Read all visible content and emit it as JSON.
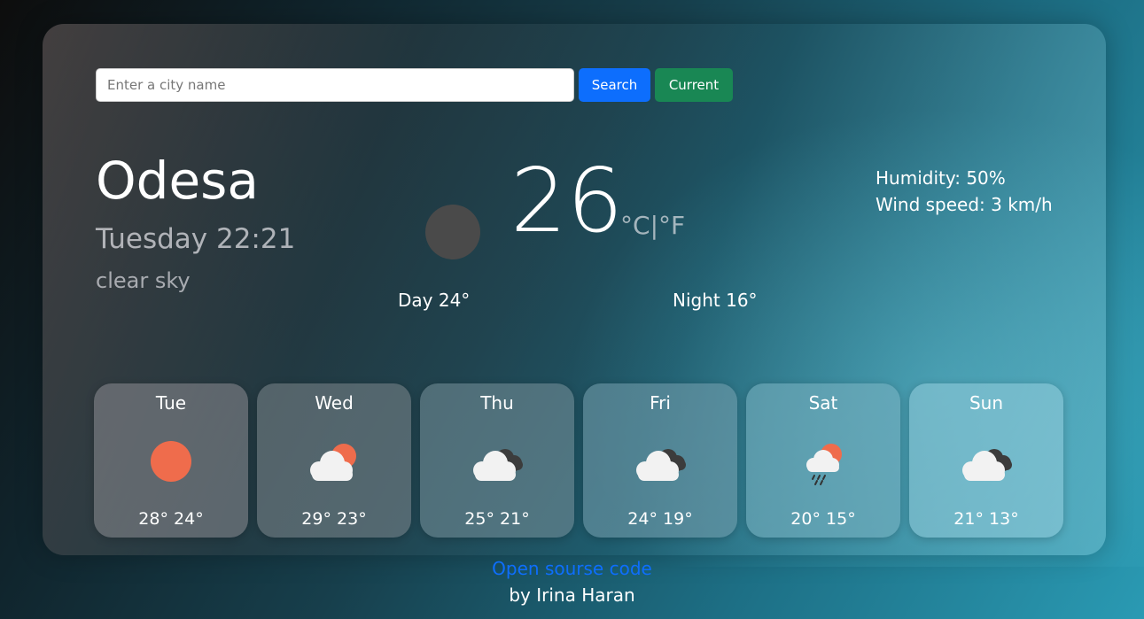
{
  "search": {
    "placeholder": "Enter a city name",
    "search_label": "Search",
    "current_label": "Current"
  },
  "current": {
    "city": "Odesa",
    "datetime": "Tuesday 22:21",
    "description": "clear sky",
    "temperature": "26",
    "unit_c": "°C",
    "unit_sep": "|",
    "unit_f": "°F",
    "humidity": "Humidity: 50%",
    "wind": "Wind speed: 3 km/h",
    "day": "Day 24°",
    "night": "Night 16°",
    "icon": "night-clear-icon"
  },
  "forecast": [
    {
      "day": "Tue",
      "temps": "28° 24°",
      "icon": "sun-icon"
    },
    {
      "day": "Wed",
      "temps": "29° 23°",
      "icon": "cloud-sun-icon"
    },
    {
      "day": "Thu",
      "temps": "25° 21°",
      "icon": "dark-clouds-icon"
    },
    {
      "day": "Fri",
      "temps": "24° 19°",
      "icon": "dark-clouds-icon"
    },
    {
      "day": "Sat",
      "temps": "20° 15°",
      "icon": "rain-sun-icon"
    },
    {
      "day": "Sun",
      "temps": "21° 13°",
      "icon": "dark-clouds-icon"
    }
  ],
  "footer": {
    "link_text": "Open sourse code",
    "author": "by Irina Haran"
  },
  "colors": {
    "search_button": "#0d6efd",
    "current_button": "#198754",
    "sun": "#ef6c4c",
    "link": "#0d6efd"
  }
}
